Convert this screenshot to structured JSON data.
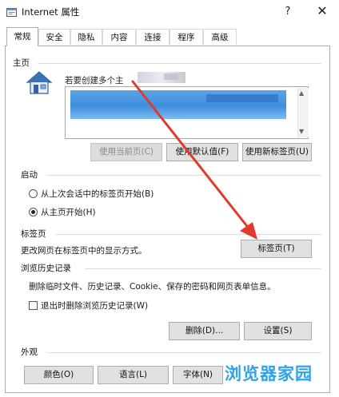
{
  "window": {
    "title": "Internet 属性",
    "help_label": "?",
    "close_label": "✕"
  },
  "tabs": [
    {
      "label": "常规",
      "active": true
    },
    {
      "label": "安全",
      "active": false
    },
    {
      "label": "隐私",
      "active": false
    },
    {
      "label": "内容",
      "active": false
    },
    {
      "label": "连接",
      "active": false
    },
    {
      "label": "程序",
      "active": false
    },
    {
      "label": "高级",
      "active": false
    }
  ],
  "homepage": {
    "group_label": "主页",
    "hint": "若要创建多个主",
    "buttons": {
      "use_current": "使用当前页(C)",
      "use_default": "使用默认值(F)",
      "use_new_tab": "使用新标签页(U)"
    }
  },
  "startup": {
    "group_label": "启动",
    "options": [
      {
        "label": "从上次会话中的标签页开始(B)",
        "checked": false
      },
      {
        "label": "从主页开始(H)",
        "checked": true
      }
    ]
  },
  "tabs_section": {
    "group_label": "标签页",
    "description": "更改网页在标签页中的显示方式。",
    "button": "标签页(T)"
  },
  "history": {
    "group_label": "浏览历史记录",
    "description": "删除临时文件、历史记录、Cookie、保存的密码和网页表单信息。",
    "checkbox_label": "退出时删除浏览历史记录(W)",
    "checkbox_checked": false,
    "delete_button": "删除(D)...",
    "settings_button": "设置(S)"
  },
  "appearance": {
    "group_label": "外观",
    "buttons": {
      "colors": "颜色(O)",
      "languages": "语言(L)",
      "fonts": "字体(N)"
    }
  },
  "watermark": "浏览器家园",
  "colors": {
    "arrow": "#e03a2a",
    "url_blur": "#3f8fe0",
    "watermark": "#2ea3ea"
  }
}
